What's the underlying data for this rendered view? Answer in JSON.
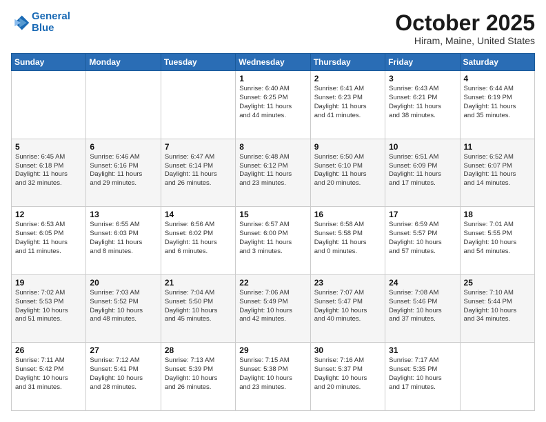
{
  "header": {
    "logo_line1": "General",
    "logo_line2": "Blue",
    "month_title": "October 2025",
    "location": "Hiram, Maine, United States"
  },
  "days_of_week": [
    "Sunday",
    "Monday",
    "Tuesday",
    "Wednesday",
    "Thursday",
    "Friday",
    "Saturday"
  ],
  "weeks": [
    [
      {
        "day": "",
        "info": ""
      },
      {
        "day": "",
        "info": ""
      },
      {
        "day": "",
        "info": ""
      },
      {
        "day": "1",
        "info": "Sunrise: 6:40 AM\nSunset: 6:25 PM\nDaylight: 11 hours\nand 44 minutes."
      },
      {
        "day": "2",
        "info": "Sunrise: 6:41 AM\nSunset: 6:23 PM\nDaylight: 11 hours\nand 41 minutes."
      },
      {
        "day": "3",
        "info": "Sunrise: 6:43 AM\nSunset: 6:21 PM\nDaylight: 11 hours\nand 38 minutes."
      },
      {
        "day": "4",
        "info": "Sunrise: 6:44 AM\nSunset: 6:19 PM\nDaylight: 11 hours\nand 35 minutes."
      }
    ],
    [
      {
        "day": "5",
        "info": "Sunrise: 6:45 AM\nSunset: 6:18 PM\nDaylight: 11 hours\nand 32 minutes."
      },
      {
        "day": "6",
        "info": "Sunrise: 6:46 AM\nSunset: 6:16 PM\nDaylight: 11 hours\nand 29 minutes."
      },
      {
        "day": "7",
        "info": "Sunrise: 6:47 AM\nSunset: 6:14 PM\nDaylight: 11 hours\nand 26 minutes."
      },
      {
        "day": "8",
        "info": "Sunrise: 6:48 AM\nSunset: 6:12 PM\nDaylight: 11 hours\nand 23 minutes."
      },
      {
        "day": "9",
        "info": "Sunrise: 6:50 AM\nSunset: 6:10 PM\nDaylight: 11 hours\nand 20 minutes."
      },
      {
        "day": "10",
        "info": "Sunrise: 6:51 AM\nSunset: 6:09 PM\nDaylight: 11 hours\nand 17 minutes."
      },
      {
        "day": "11",
        "info": "Sunrise: 6:52 AM\nSunset: 6:07 PM\nDaylight: 11 hours\nand 14 minutes."
      }
    ],
    [
      {
        "day": "12",
        "info": "Sunrise: 6:53 AM\nSunset: 6:05 PM\nDaylight: 11 hours\nand 11 minutes."
      },
      {
        "day": "13",
        "info": "Sunrise: 6:55 AM\nSunset: 6:03 PM\nDaylight: 11 hours\nand 8 minutes."
      },
      {
        "day": "14",
        "info": "Sunrise: 6:56 AM\nSunset: 6:02 PM\nDaylight: 11 hours\nand 6 minutes."
      },
      {
        "day": "15",
        "info": "Sunrise: 6:57 AM\nSunset: 6:00 PM\nDaylight: 11 hours\nand 3 minutes."
      },
      {
        "day": "16",
        "info": "Sunrise: 6:58 AM\nSunset: 5:58 PM\nDaylight: 11 hours\nand 0 minutes."
      },
      {
        "day": "17",
        "info": "Sunrise: 6:59 AM\nSunset: 5:57 PM\nDaylight: 10 hours\nand 57 minutes."
      },
      {
        "day": "18",
        "info": "Sunrise: 7:01 AM\nSunset: 5:55 PM\nDaylight: 10 hours\nand 54 minutes."
      }
    ],
    [
      {
        "day": "19",
        "info": "Sunrise: 7:02 AM\nSunset: 5:53 PM\nDaylight: 10 hours\nand 51 minutes."
      },
      {
        "day": "20",
        "info": "Sunrise: 7:03 AM\nSunset: 5:52 PM\nDaylight: 10 hours\nand 48 minutes."
      },
      {
        "day": "21",
        "info": "Sunrise: 7:04 AM\nSunset: 5:50 PM\nDaylight: 10 hours\nand 45 minutes."
      },
      {
        "day": "22",
        "info": "Sunrise: 7:06 AM\nSunset: 5:49 PM\nDaylight: 10 hours\nand 42 minutes."
      },
      {
        "day": "23",
        "info": "Sunrise: 7:07 AM\nSunset: 5:47 PM\nDaylight: 10 hours\nand 40 minutes."
      },
      {
        "day": "24",
        "info": "Sunrise: 7:08 AM\nSunset: 5:46 PM\nDaylight: 10 hours\nand 37 minutes."
      },
      {
        "day": "25",
        "info": "Sunrise: 7:10 AM\nSunset: 5:44 PM\nDaylight: 10 hours\nand 34 minutes."
      }
    ],
    [
      {
        "day": "26",
        "info": "Sunrise: 7:11 AM\nSunset: 5:42 PM\nDaylight: 10 hours\nand 31 minutes."
      },
      {
        "day": "27",
        "info": "Sunrise: 7:12 AM\nSunset: 5:41 PM\nDaylight: 10 hours\nand 28 minutes."
      },
      {
        "day": "28",
        "info": "Sunrise: 7:13 AM\nSunset: 5:39 PM\nDaylight: 10 hours\nand 26 minutes."
      },
      {
        "day": "29",
        "info": "Sunrise: 7:15 AM\nSunset: 5:38 PM\nDaylight: 10 hours\nand 23 minutes."
      },
      {
        "day": "30",
        "info": "Sunrise: 7:16 AM\nSunset: 5:37 PM\nDaylight: 10 hours\nand 20 minutes."
      },
      {
        "day": "31",
        "info": "Sunrise: 7:17 AM\nSunset: 5:35 PM\nDaylight: 10 hours\nand 17 minutes."
      },
      {
        "day": "",
        "info": ""
      }
    ]
  ]
}
